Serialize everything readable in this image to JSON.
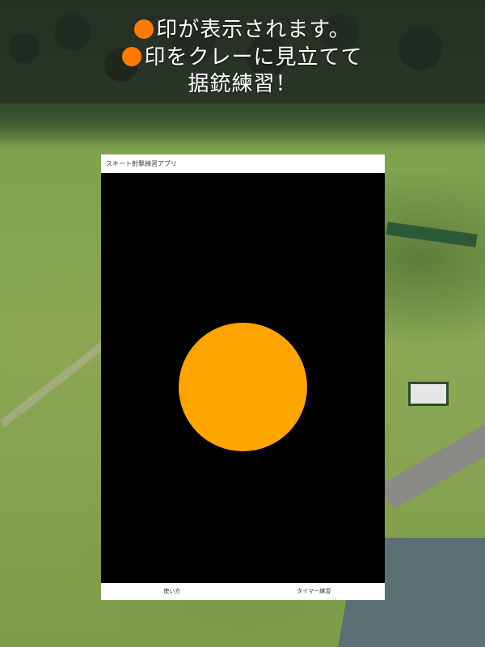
{
  "banner": {
    "line1": "印が表示されます。",
    "line2": "印をクレーに見立てて",
    "line3": "据銃練習！"
  },
  "app": {
    "title": "スキート射撃練習アプリ",
    "footer": {
      "howto_label": "使い方",
      "timer_label": "タイマー練習"
    }
  },
  "colors": {
    "banner_dot": "#ff7a00",
    "target": "#ffa500",
    "stage_bg": "#000000"
  },
  "icons": [
    "orange-dot-icon"
  ]
}
